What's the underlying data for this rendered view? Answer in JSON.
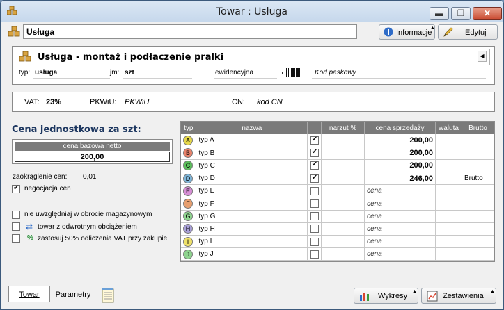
{
  "window": {
    "title": "Towar : Usługa"
  },
  "name_field": {
    "value": "Usługa"
  },
  "toolbar": {
    "info_label": "Informacje",
    "edit_label": "Edytuj"
  },
  "header": {
    "title": "Usługa - montaż i podłaczenie pralki",
    "typ_label": "typ:",
    "typ_value": "usługa",
    "jm_label": "jm:",
    "jm_value": "szt",
    "ewid_label": "ewidencyjna",
    "barcode_placeholder": "Kod paskowy"
  },
  "vat": {
    "vat_label": "VAT:",
    "vat_value": "23%",
    "pkwiu_label": "PKWiU:",
    "pkwiu_value": "PKWiU",
    "cn_label": "CN:",
    "cn_value": "kod CN"
  },
  "prices": {
    "title": "Cena jednostkowa za szt:",
    "base_header": "cena bazowa netto",
    "base_value": "200,00",
    "rounding_label": "zaokrąglenie cen:",
    "rounding_value": "0,01",
    "negotiation_label": "negocjacja cen",
    "exclude_label": "nie uwzględniaj w obrocie magazynowym",
    "reverse_label": "towar z odwrotnym obciążeniem",
    "vat50_label": "zastosuj 50% odliczenia VAT przy zakupie"
  },
  "table": {
    "headers": [
      "typ",
      "nazwa",
      "",
      "narzut %",
      "cena sprzedaży",
      "waluta",
      "Brutto"
    ],
    "rows": [
      {
        "badge": "A",
        "color": "#e6d84a",
        "name": "typ A",
        "checked": true,
        "markup": "",
        "price": "200,00",
        "currency": "",
        "brutto": ""
      },
      {
        "badge": "B",
        "color": "#e8826a",
        "name": "typ B",
        "checked": true,
        "markup": "",
        "price": "200,00",
        "currency": "",
        "brutto": ""
      },
      {
        "badge": "C",
        "color": "#5cbf5c",
        "name": "typ C",
        "checked": true,
        "markup": "",
        "price": "200,00",
        "currency": "",
        "brutto": ""
      },
      {
        "badge": "D",
        "color": "#7fb6d9",
        "name": "typ D",
        "checked": true,
        "markup": "",
        "price": "246,00",
        "currency": "",
        "brutto": "Brutto"
      },
      {
        "badge": "E",
        "color": "#d78fd6",
        "name": "typ E",
        "checked": false,
        "markup": "",
        "price": "cena",
        "currency": "",
        "brutto": ""
      },
      {
        "badge": "F",
        "color": "#e8a070",
        "name": "typ F",
        "checked": false,
        "markup": "",
        "price": "cena",
        "currency": "",
        "brutto": ""
      },
      {
        "badge": "G",
        "color": "#8fd48f",
        "name": "typ G",
        "checked": false,
        "markup": "",
        "price": "cena",
        "currency": "",
        "brutto": ""
      },
      {
        "badge": "H",
        "color": "#a9a0d8",
        "name": "typ H",
        "checked": false,
        "markup": "",
        "price": "cena",
        "currency": "",
        "brutto": ""
      },
      {
        "badge": "I",
        "color": "#efe16a",
        "name": "typ I",
        "checked": false,
        "markup": "",
        "price": "cena",
        "currency": "",
        "brutto": ""
      },
      {
        "badge": "J",
        "color": "#8fd48f",
        "name": "typ J",
        "checked": false,
        "markup": "",
        "price": "cena",
        "currency": "",
        "brutto": ""
      }
    ]
  },
  "bottom": {
    "tab_towar": "Towar",
    "tab_parametry": "Parametry",
    "wykresy_label": "Wykresy",
    "zestawienia_label": "Zestawienia"
  }
}
